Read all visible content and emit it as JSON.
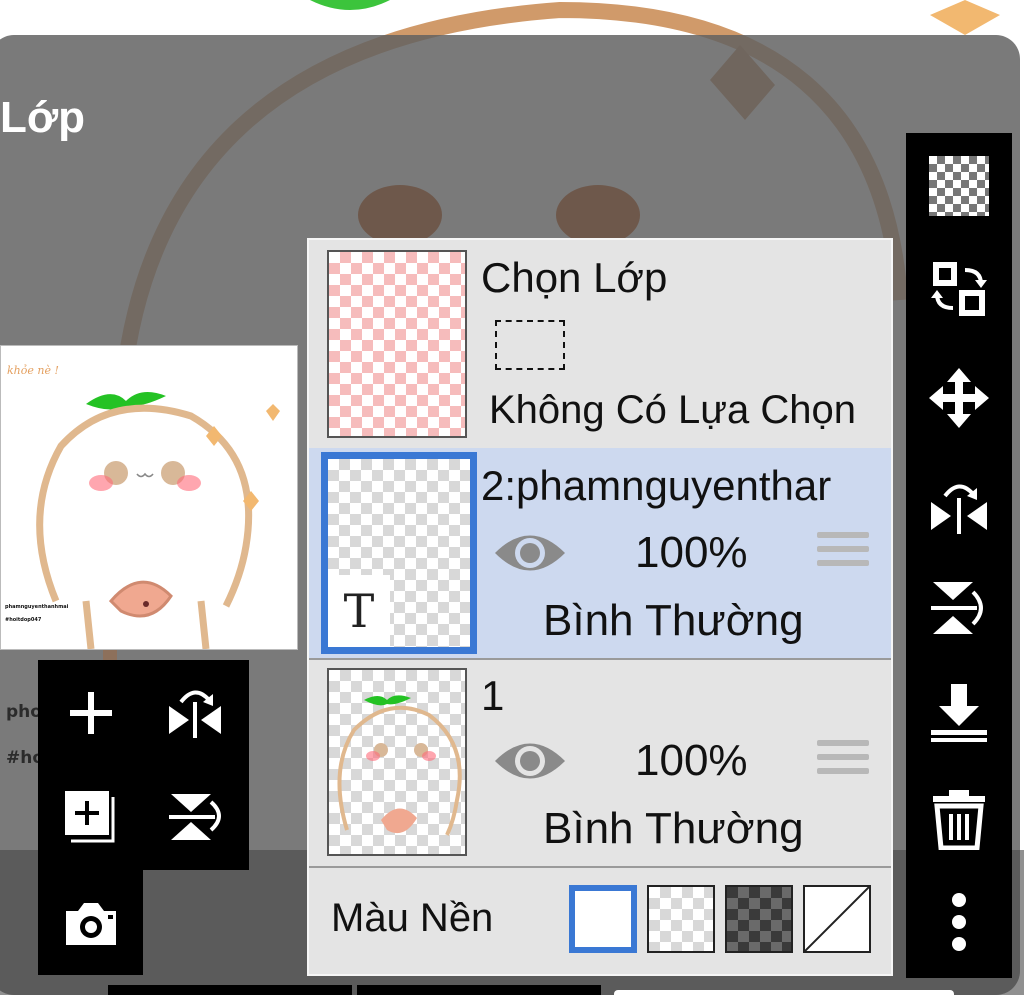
{
  "dialog": {
    "title": "Lớp"
  },
  "preview": {
    "handwriting": "khỏe\nnè !",
    "caption_line1": "phamnguyenthanhmai",
    "caption_line2": "#hoitdop047",
    "side_text_1": "pho",
    "side_text_2": "#ho"
  },
  "selection_row": {
    "title": "Chọn Lớp",
    "status": "Không Có Lựa Chọn"
  },
  "layers": [
    {
      "name": "2:phamnguyenthar",
      "opacity": "100%",
      "blend": "Bình Thường",
      "type_label": "T",
      "selected": true
    },
    {
      "name": "1",
      "opacity": "100%",
      "blend": "Bình Thường",
      "selected": false
    }
  ],
  "background_color": {
    "label": "Màu Nền",
    "options": [
      "white",
      "transparent",
      "dark-checker",
      "none"
    ],
    "selected": "white"
  },
  "left_tools": [
    "add-layer-icon",
    "flip-horizontal-icon",
    "add-layer-from-copy-icon",
    "flip-vertical-icon",
    "camera-icon"
  ],
  "right_tools": [
    "transparency-icon",
    "swap-layers-icon",
    "move-icon",
    "flip-horizontal-icon",
    "flip-vertical-icon",
    "merge-down-icon",
    "trash-icon",
    "more-vertical-icon"
  ],
  "colors": {
    "accent": "#3a78d4",
    "selected_row": "#cdd9ef",
    "panel": "#e4e4e4",
    "toolbar": "#000000"
  }
}
